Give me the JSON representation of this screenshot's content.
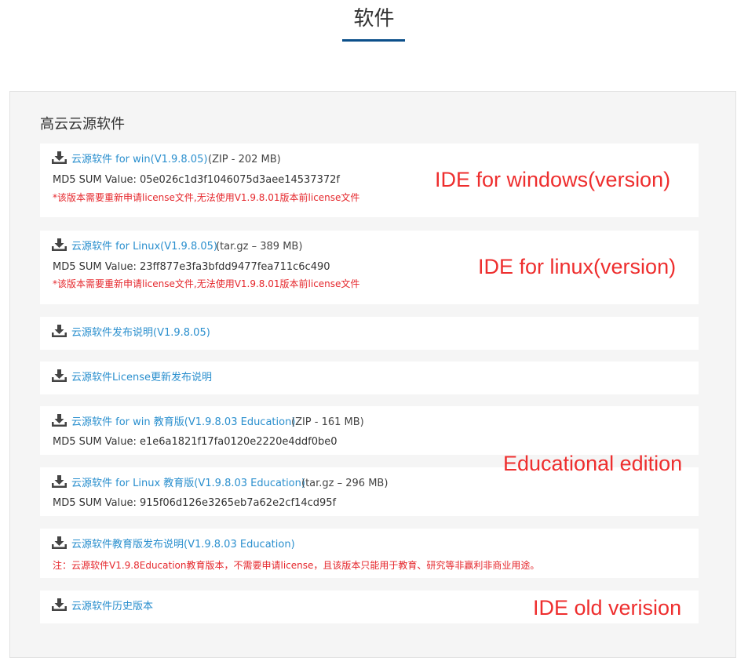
{
  "page": {
    "title": "软件"
  },
  "section": {
    "title": "高云云源软件"
  },
  "items": [
    {
      "link": "云源软件 for win(V1.9.8.05)",
      "meta": "(ZIP - 202 MB)",
      "md5": "MD5 SUM Value:  05e026c1d3f1046075d3aee14537372f",
      "note": "*该版本需要重新申请license文件,无法使用V1.9.8.01版本前license文件"
    },
    {
      "link": "云源软件 for Linux(V1.9.8.05)",
      "meta": "(tar.gz – 389 MB)",
      "md5": "MD5 SUM Value:  23ff877e3fa3bfdd9477fea711c6c490",
      "note": "*该版本需要重新申请license文件,无法使用V1.9.8.01版本前license文件"
    },
    {
      "link": "云源软件发布说明(V1.9.8.05)"
    },
    {
      "link": "云源软件License更新发布说明"
    },
    {
      "link": "云源软件 for win 教育版(V1.9.8.03 Education)",
      "meta": "(ZIP - 161 MB)",
      "md5": "MD5 SUM Value:  e1e6a1821f17fa0120e2220e4ddf0be0"
    },
    {
      "link": "云源软件 for Linux 教育版(V1.9.8.03 Education)",
      "meta": "(tar.gz – 296 MB)",
      "md5": "MD5 SUM Value:  915f06d126e3265eb7a62e2cf14cd95f"
    },
    {
      "link": "云源软件教育版发布说明(V1.9.8.03 Education)",
      "note": "注：云源软件V1.9.8Education教育版本，不需要申请license，且该版本只能用于教育、研究等非赢利非商业用途。"
    },
    {
      "link": "云源软件历史版本"
    }
  ],
  "annotations": {
    "windows": "IDE for windows(version)",
    "linux": "IDE for linux(version)",
    "edu": "Educational edition",
    "old": "IDE old verision"
  },
  "colors": {
    "link": "#2a8fce",
    "note": "#e5272c",
    "annotation": "#ee2e2e",
    "accent": "#0b4f8a"
  },
  "icons": {
    "download": "download-icon"
  }
}
